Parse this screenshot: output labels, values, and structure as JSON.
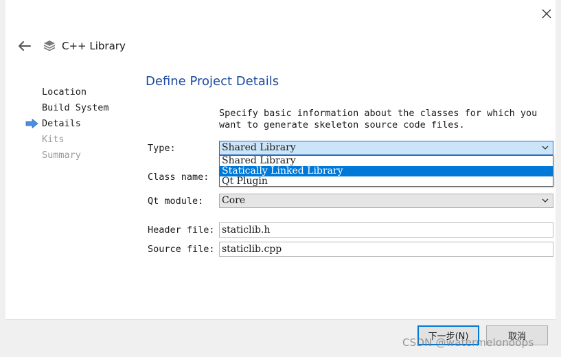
{
  "header": {
    "title": "C++ Library",
    "back_icon": "arrow-left-icon",
    "library_icon": "stacked-layers-icon"
  },
  "close_icon": "close-icon",
  "steps": [
    {
      "label": "Location",
      "state": "done"
    },
    {
      "label": "Build System",
      "state": "done"
    },
    {
      "label": "Details",
      "state": "current"
    },
    {
      "label": "Kits",
      "state": "disabled"
    },
    {
      "label": "Summary",
      "state": "disabled"
    }
  ],
  "page": {
    "title": "Define Project Details",
    "description": "Specify basic information about the classes for which you\nwant to generate skeleton source code files."
  },
  "form": {
    "type_label": "Type:",
    "type_value": "Shared Library",
    "type_options": [
      "Shared Library",
      "Statically Linked Library",
      "Qt Plugin"
    ],
    "type_highlighted": "Statically Linked Library",
    "class_name_label": "Class name:",
    "qt_module_label": "Qt module:",
    "qt_module_value": "Core",
    "header_file_label": "Header file:",
    "header_file_value": "staticlib.h",
    "source_file_label": "Source file:",
    "source_file_value": "staticlib.cpp"
  },
  "buttons": {
    "next_label": "下一步(N)",
    "cancel_label": "取消"
  },
  "watermark": "CSDN @watermelonoops",
  "colors": {
    "accent": "#0078d7",
    "title_blue": "#1c4aa0",
    "step_arrow": "#4a90e2"
  }
}
